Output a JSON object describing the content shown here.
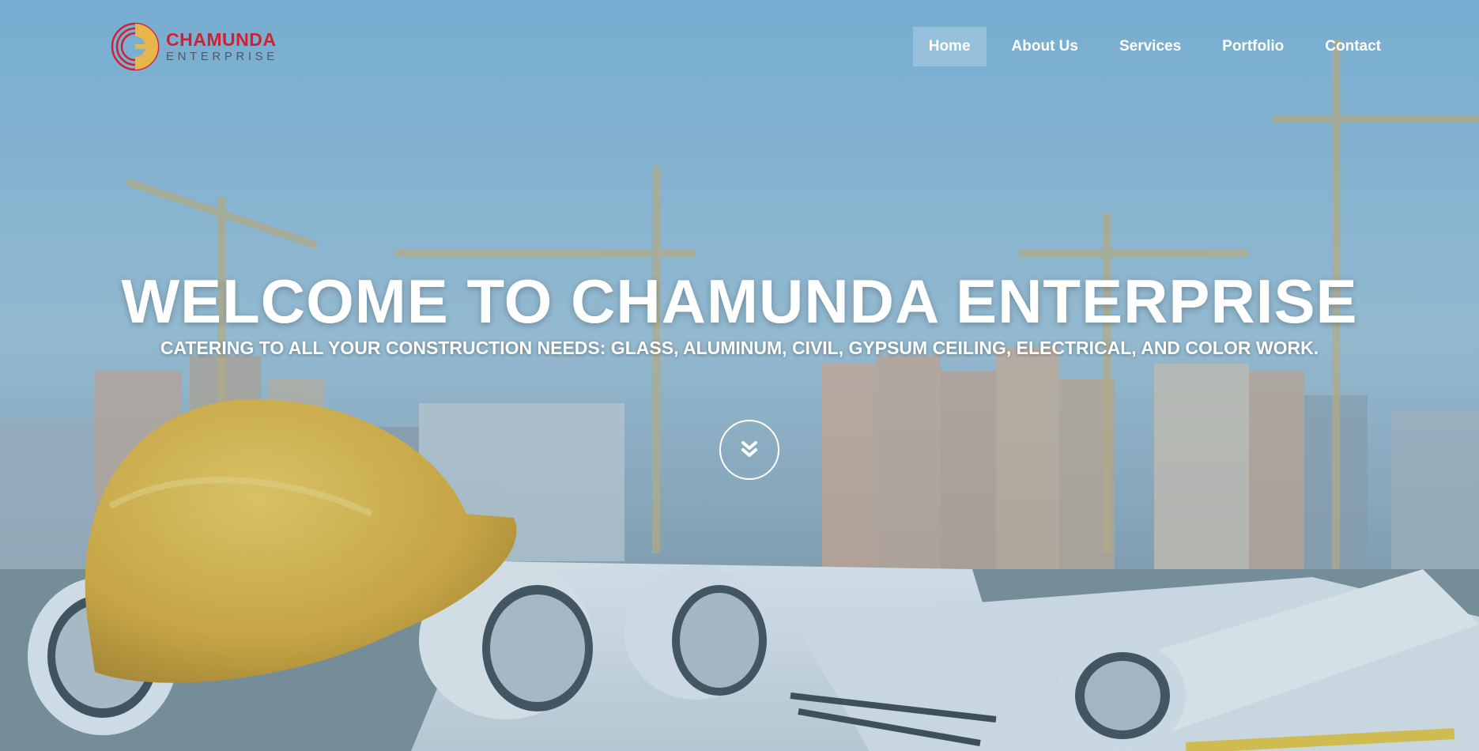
{
  "brand": {
    "name": "CHAMUNDA",
    "tagline": "ENTERPRISE",
    "logo_icon": "chamunda-logo-mark",
    "primary_color": "#cf2230",
    "accent_color": "#e8b54a"
  },
  "nav": {
    "items": [
      {
        "label": "Home",
        "active": true
      },
      {
        "label": "About Us",
        "active": false
      },
      {
        "label": "Services",
        "active": false
      },
      {
        "label": "Portfolio",
        "active": false
      },
      {
        "label": "Contact",
        "active": false
      }
    ]
  },
  "hero": {
    "title": "WELCOME TO CHAMUNDA ENTERPRISE",
    "subtitle": "CATERING TO ALL YOUR CONSTRUCTION NEEDS: GLASS, ALUMINUM, CIVIL, GYPSUM CEILING, ELECTRICAL, AND COLOR WORK.",
    "scroll_icon": "double-chevron-down-icon",
    "background_image": "construction-site-hardhat-blueprints"
  }
}
